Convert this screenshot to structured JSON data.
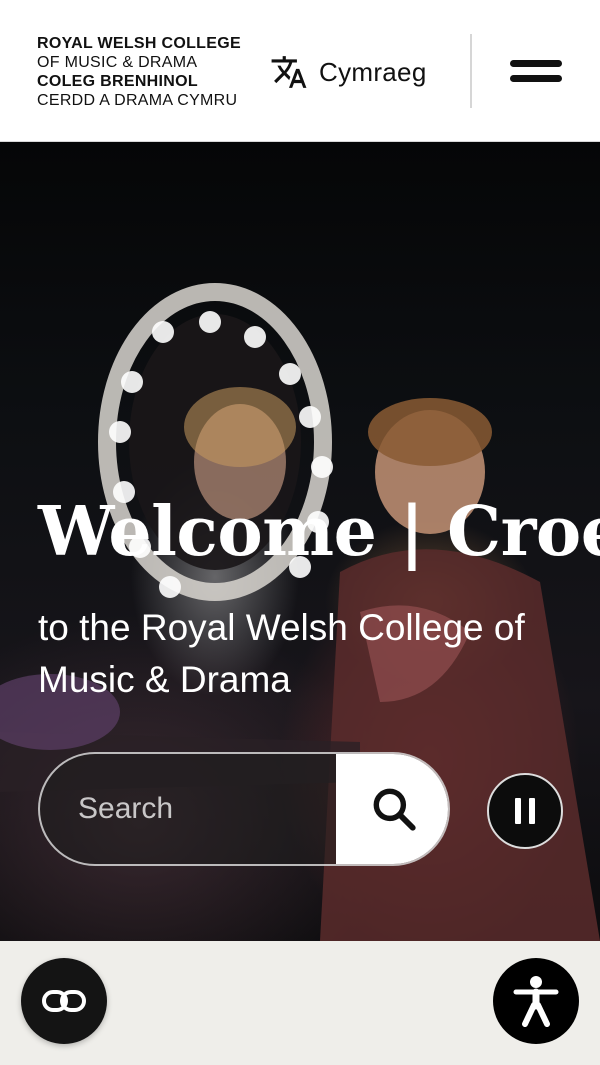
{
  "header": {
    "logo": {
      "line1": "ROYAL WELSH COLLEGE",
      "line2": "OF MUSIC & DRAMA",
      "line3": "COLEG BRENHINOL",
      "line4": "CERDD A DRAMA CYMRU"
    },
    "language_label": "Cymraeg",
    "icons": {
      "language": "translate-icon",
      "menu": "hamburger-menu-icon"
    }
  },
  "hero": {
    "title": "Welcome | Croeso",
    "subtitle": "to the Royal Welsh College of Music & Drama",
    "search": {
      "placeholder": "Search",
      "value": ""
    },
    "icons": {
      "search": "search-icon",
      "pause": "pause-icon"
    }
  },
  "floating": {
    "left_icon": "link-icon",
    "right_icon": "accessibility-icon"
  },
  "colors": {
    "header_bg": "#ffffff",
    "text_dark": "#111111",
    "hero_text": "#ffffff",
    "footer_bg": "#efeeea",
    "fab_dark": "#141414"
  }
}
